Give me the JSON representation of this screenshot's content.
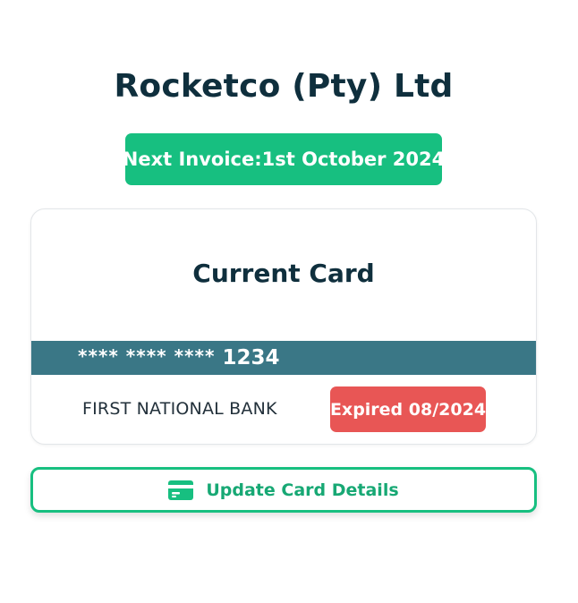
{
  "company": {
    "name": "Rocketco (Pty) Ltd"
  },
  "invoice": {
    "label": "Next Invoice:",
    "date": "1st October 2024"
  },
  "card": {
    "title": "Current Card",
    "number_masked": "**** **** ****",
    "number_last4": "1234",
    "bank": "FIRST NATIONAL BANK",
    "status": "Expired 08/2024"
  },
  "actions": {
    "update_label": "Update Card Details",
    "update_icon": "credit-card-icon"
  },
  "colors": {
    "brand_green": "#17bf80",
    "strip_teal": "#3a7786",
    "expired_red": "#e85655",
    "heading_navy": "#0f2f3d"
  }
}
